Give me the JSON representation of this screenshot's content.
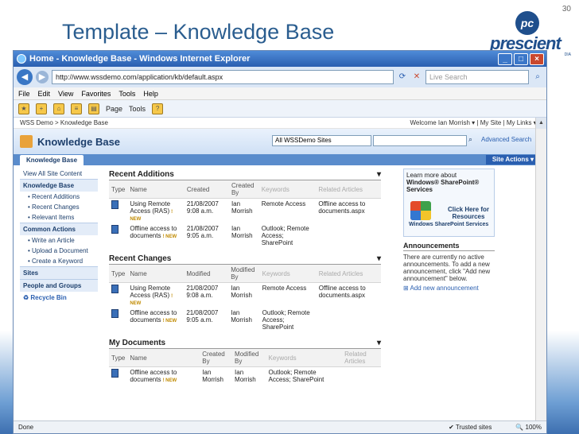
{
  "slide": {
    "number": "30",
    "title": "Template – Knowledge Base",
    "logo_mark": "pc",
    "logo_word": "prescient",
    "logo_sub": "DIA"
  },
  "browser": {
    "window_title": "Home - Knowledge Base - Windows Internet Explorer",
    "url": "http://www.wssdemo.com/application/kb/default.aspx",
    "search_placeholder": "Live Search",
    "menu": [
      "File",
      "Edit",
      "View",
      "Favorites",
      "Tools",
      "Help"
    ],
    "cmd_page": "Page",
    "cmd_tools": "Tools",
    "status_done": "Done",
    "status_zone": "Trusted sites",
    "zoom": "100%"
  },
  "sharepoint": {
    "breadcrumb": "WSS Demo > Knowledge Base",
    "welcome": "Welcome Ian Morrish ▾ | My Site | My Links ▾ |",
    "site_title": "Knowledge Base",
    "scope": "All WSSDemo Sites",
    "advanced_search": "Advanced Search",
    "tab": "Knowledge Base",
    "site_actions": "Site Actions ▾",
    "quicklaunch": {
      "view_all": "View All Site Content",
      "kb_head": "Knowledge Base",
      "kb_items": [
        "Recent Additions",
        "Recent Changes",
        "Relevant Items"
      ],
      "actions_head": "Common Actions",
      "action_items": [
        "Write an Article",
        "Upload a Document",
        "Create a Keyword"
      ],
      "sites": "Sites",
      "people": "People and Groups",
      "recycle": "Recycle Bin"
    },
    "recent_additions": {
      "title": "Recent Additions",
      "headers": [
        "Type",
        "Name",
        "Created",
        "Created By",
        "Keywords",
        "Related Articles"
      ],
      "rows": [
        {
          "name": "Using Remote Access (RAS)",
          "date": "21/08/2007 9:08 a.m.",
          "by": "Ian Morrish",
          "keywords": "Remote Access",
          "related": "Offline access to documents.aspx"
        },
        {
          "name": "Offline access to documents",
          "date": "21/08/2007 9:05 a.m.",
          "by": "Ian Morrish",
          "keywords": "Outlook; Remote Access; SharePoint",
          "related": ""
        }
      ]
    },
    "recent_changes": {
      "title": "Recent Changes",
      "headers": [
        "Type",
        "Name",
        "Modified",
        "Modified By",
        "Keywords",
        "Related Articles"
      ],
      "rows": [
        {
          "name": "Using Remote Access (RAS)",
          "date": "21/08/2007 9:08 a.m.",
          "by": "Ian Morrish",
          "keywords": "Remote Access",
          "related": "Offline access to documents.aspx"
        },
        {
          "name": "Offline access to documents",
          "date": "21/08/2007 9:05 a.m.",
          "by": "Ian Morrish",
          "keywords": "Outlook; Remote Access; SharePoint",
          "related": ""
        }
      ]
    },
    "my_documents": {
      "title": "My Documents",
      "headers": [
        "Type",
        "Name",
        "Created By",
        "Modified By",
        "Keywords",
        "Related Articles"
      ],
      "rows": [
        {
          "name": "Offline access to documents",
          "created_by": "Ian Morrish",
          "modified_by": "Ian Morrish",
          "keywords": "Outlook; Remote Access; SharePoint"
        }
      ]
    },
    "new_label": "! NEW",
    "promo": {
      "text": "Learn more about",
      "bold": "Windows® SharePoint® Services",
      "win_text": "Windows SharePoint Services",
      "click": "Click Here for Resources"
    },
    "announcements": {
      "title": "Announcements",
      "text": "There are currently no active announcements. To add a new announcement, click \"Add new announcement\" below.",
      "add": "Add new announcement"
    }
  },
  "colors": {
    "title_blue": "#2a5d8f",
    "sp_dark": "#1d3f6c",
    "link_blue": "#2a5fb0"
  }
}
